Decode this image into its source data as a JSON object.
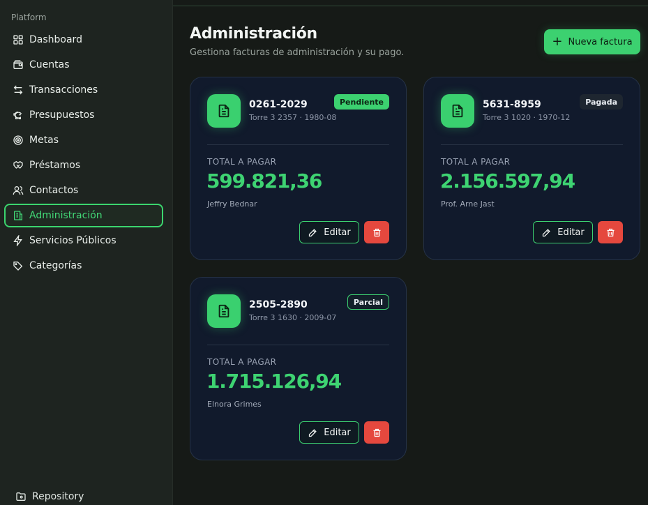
{
  "sidebar": {
    "group_label": "Platform",
    "items": [
      {
        "label": "Dashboard",
        "icon": "dashboard-icon"
      },
      {
        "label": "Cuentas",
        "icon": "wallet-icon"
      },
      {
        "label": "Transacciones",
        "icon": "arrows-icon"
      },
      {
        "label": "Presupuestos",
        "icon": "piggy-bank-icon"
      },
      {
        "label": "Metas",
        "icon": "target-icon"
      },
      {
        "label": "Préstamos",
        "icon": "handshake-icon"
      },
      {
        "label": "Contactos",
        "icon": "users-icon"
      },
      {
        "label": "Administración",
        "icon": "building-icon",
        "active": true
      },
      {
        "label": "Servicios Públicos",
        "icon": "zap-icon"
      },
      {
        "label": "Categorías",
        "icon": "tags-icon"
      }
    ],
    "footer_link": "Repository"
  },
  "header": {
    "title": "Administración",
    "subtitle": "Gestiona facturas de administración y su pago.",
    "new_button": "Nueva factura"
  },
  "cards": [
    {
      "code": "0261-2029",
      "meta": "Torre 3 2357 · 1980-08",
      "status": "Pendiente",
      "total_label": "TOTAL A PAGAR",
      "amount": "599.821,36",
      "person": "Jeffry Bednar",
      "edit_label": "Editar"
    },
    {
      "code": "5631-8959",
      "meta": "Torre 3 1020 · 1970-12",
      "status": "Pagada",
      "total_label": "TOTAL A PAGAR",
      "amount": "2.156.597,94",
      "person": "Prof. Arne Jast",
      "edit_label": "Editar"
    },
    {
      "code": "2505-2890",
      "meta": "Torre 3 1630 · 2009-07",
      "status": "Parcial",
      "total_label": "TOTAL A PAGAR",
      "amount": "1.715.126,94",
      "person": "Elnora Grimes",
      "edit_label": "Editar"
    }
  ],
  "colors": {
    "accent": "#3cd170",
    "danger": "#e5483e",
    "card_bg": "#111a2c"
  }
}
